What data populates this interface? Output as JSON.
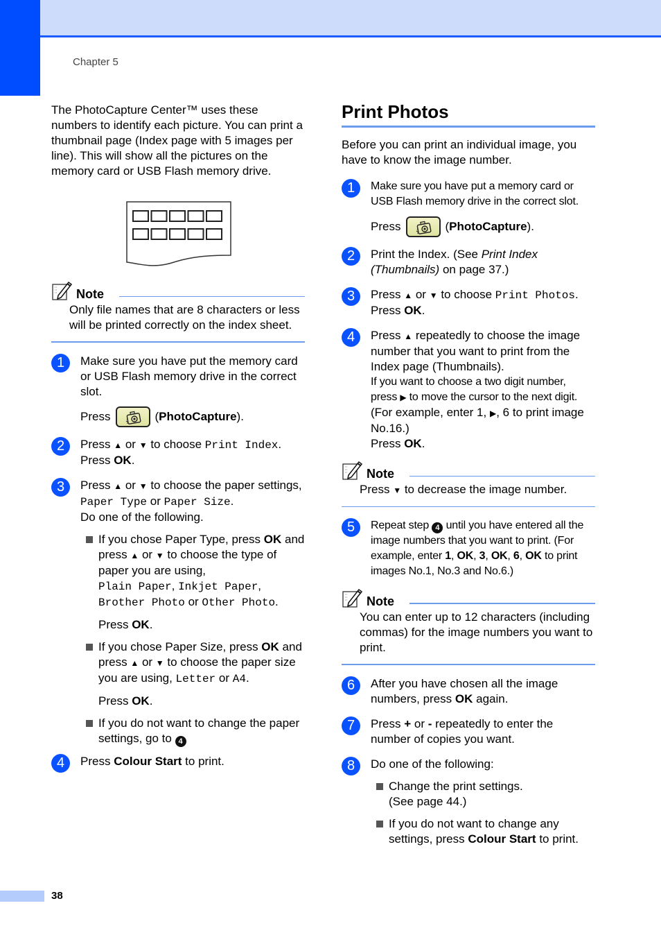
{
  "header": {
    "chapter": "Chapter 5"
  },
  "colors": {
    "accent": "#004dff",
    "header_band": "#cddcfb",
    "rule": "#6b9bef",
    "step_badge": "#0a52ff"
  },
  "left": {
    "intro": "The PhotoCapture Center™ uses these numbers to identify each picture. You can print a thumbnail page (Index page with 5 images per line). This will show all the pictures on the memory card or USB Flash memory drive.",
    "figure": {
      "name": "index-page-illustration",
      "rows": 2,
      "images_per_row": 5
    },
    "note": {
      "title": "Note",
      "body": "Only file names that are 8 characters or less will be printed correctly on the index sheet."
    },
    "steps": [
      {
        "num": "1",
        "text": "Make sure you have put the memory card or USB Flash memory drive in the correct slot.",
        "press": "Press",
        "button_label": "PhotoCapture"
      },
      {
        "num": "2",
        "pre": "Press",
        "up": "▲",
        "or": "or",
        "down": "▼",
        "mid": "to choose",
        "option": "Print Index",
        "end": ".",
        "press": "Press",
        "ok": "OK"
      },
      {
        "num": "3",
        "pre": "Press",
        "up": "▲",
        "or": "or",
        "down": "▼",
        "mid": "to choose the paper settings,",
        "opt1": "Paper Type",
        "or2": "or",
        "opt2": "Paper Size",
        "tail": "Do one of the following.",
        "bullets": [
          {
            "a": "If you chose Paper Type, press",
            "ok": "OK",
            "b": "and press",
            "c": "to choose the type of paper you are using,",
            "opts": [
              "Plain Paper",
              "Inkjet Paper",
              "Brother Photo",
              "Other Photo"
            ],
            "or": "or",
            "press": "Press",
            "ok2": "OK"
          },
          {
            "a": "If you chose Paper Size, press",
            "ok": "OK",
            "b": "and press",
            "c": "to choose the paper size you are using,",
            "opts": [
              "Letter",
              "A4"
            ],
            "or": "or",
            "press": "Press",
            "ok2": "OK"
          },
          {
            "a": "If you do not want to change the paper settings, go to",
            "ref": "4"
          }
        ]
      },
      {
        "num": "4",
        "pre": "Press",
        "bold": "Colour Start",
        "post": "to print."
      }
    ]
  },
  "right": {
    "title": "Print Photos",
    "intro": "Before you can print an individual image, you have to know the image number.",
    "steps": [
      {
        "num": "1",
        "text": "Make sure you have put a memory card or USB Flash memory drive in the correct slot.",
        "press": "Press",
        "button_label": "PhotoCapture"
      },
      {
        "num": "2",
        "pre": "Print the Index. (See",
        "italic": "Print Index (Thumbnails)",
        "post": "on page 37.)"
      },
      {
        "num": "3",
        "pre": "Press",
        "mid": "to choose",
        "option": "Print Photos",
        "press": "Press",
        "ok": "OK"
      },
      {
        "num": "4",
        "l1": "Press",
        "l1b": "repeatedly to choose the image number that you want to print from the Index page (Thumbnails).",
        "l2": "If you want to choose a two digit number, press",
        "l2b": "to move the cursor to the next digit.",
        "l3": "(For example, enter 1,",
        "l3b": ", 6 to print image No.16.)",
        "press": "Press",
        "ok": "OK"
      },
      {
        "num": "5",
        "a": "Repeat step",
        "ref": "4",
        "b": "until you have entered all the image numbers that you want to print. (For example, enter",
        "seq": [
          "1",
          "OK",
          "3",
          "OK",
          "6",
          "OK"
        ],
        "c": "to print images No.1, No.3 and No.6.)"
      },
      {
        "num": "6",
        "a": "After you have chosen all the image numbers, press",
        "ok": "OK",
        "b": "again."
      },
      {
        "num": "7",
        "a": "Press",
        "plus": "+",
        "or": "or",
        "minus": "-",
        "b": "repeatedly to enter the number of copies you want."
      },
      {
        "num": "8",
        "a": "Do one of the following:",
        "bullets": [
          {
            "a": "Change the print settings.",
            "b": "(See page 44.)"
          },
          {
            "a": "If you do not want to change any settings, press",
            "bold": "Colour Start",
            "post": "to print."
          }
        ]
      }
    ],
    "notes": [
      {
        "title": "Note",
        "pre": "Press",
        "down": "▼",
        "post": "to decrease the image number."
      },
      {
        "title": "Note",
        "body": "You can enter up to 12 characters (including commas) for the image numbers you want to print."
      }
    ],
    "arrows": {
      "up": "▲",
      "down": "▼",
      "right": "▶"
    },
    "or": "or"
  },
  "footer": {
    "page_number": "38"
  }
}
